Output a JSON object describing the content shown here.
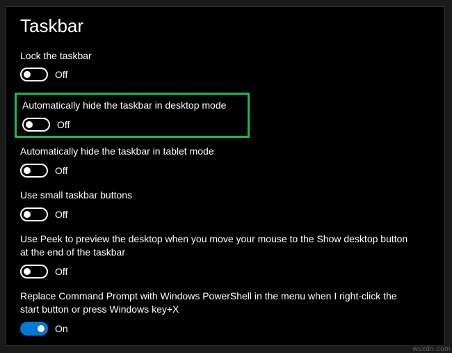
{
  "title": "Taskbar",
  "highlightedIndex": 1,
  "stateLabels": {
    "on": "On",
    "off": "Off"
  },
  "settings": [
    {
      "id": "lock-taskbar",
      "label": "Lock the taskbar",
      "value": false
    },
    {
      "id": "hide-desktop",
      "label": "Automatically hide the taskbar in desktop mode",
      "value": false
    },
    {
      "id": "hide-tablet",
      "label": "Automatically hide the taskbar in tablet mode",
      "value": false
    },
    {
      "id": "small-buttons",
      "label": "Use small taskbar buttons",
      "value": false
    },
    {
      "id": "use-peek",
      "label": "Use Peek to preview the desktop when you move your mouse to the Show desktop button at the end of the taskbar",
      "value": false
    },
    {
      "id": "replace-cmd",
      "label": "Replace Command Prompt with Windows PowerShell in the menu when I right-click the start button or press Windows key+X",
      "value": true
    }
  ],
  "sourceWatermark": "wsxdn.com"
}
